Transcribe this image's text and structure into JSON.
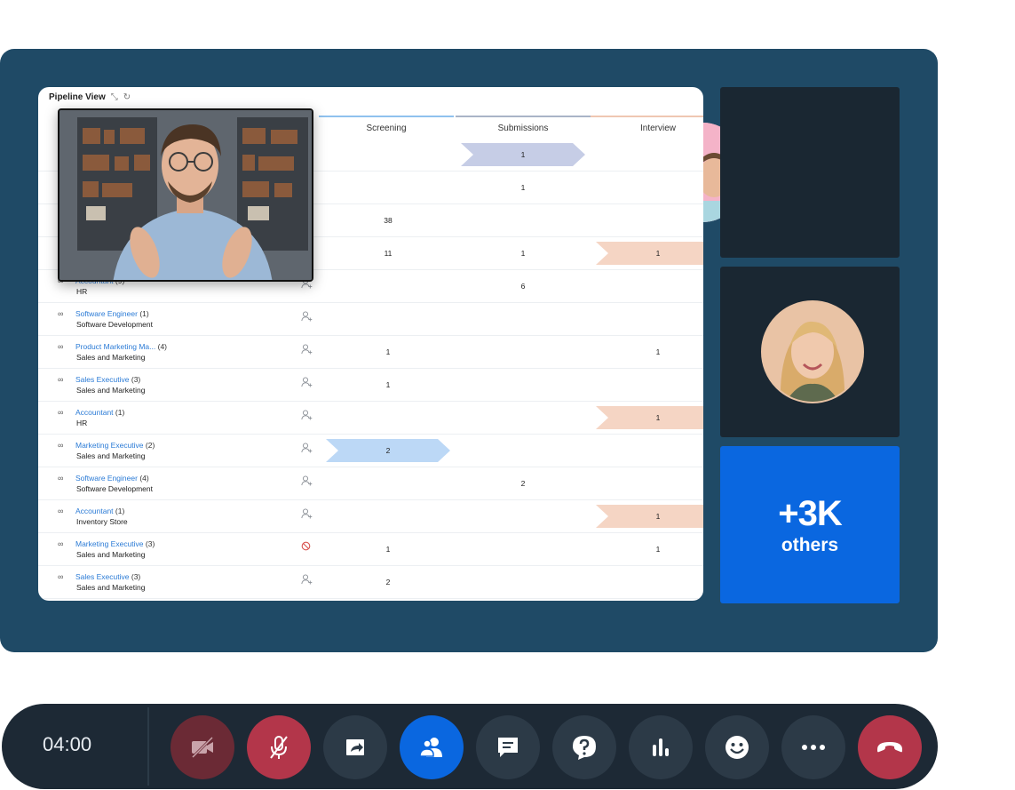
{
  "pipeline": {
    "title": "Pipeline View",
    "stages": [
      "Screening",
      "Submissions",
      "Interview"
    ],
    "rows": [
      {
        "job": "",
        "count": "",
        "dept": "",
        "cells": [
          "",
          {
            "v": "1",
            "chev": "slate"
          },
          ""
        ]
      },
      {
        "job": "",
        "count": "",
        "dept": "",
        "cells": [
          "",
          "1",
          ""
        ]
      },
      {
        "job": "",
        "count": "",
        "dept": "",
        "cells": [
          "38",
          "",
          ""
        ]
      },
      {
        "job": "",
        "count": "",
        "dept": "",
        "cells": [
          "11",
          "1",
          {
            "v": "1",
            "chev": "peach"
          }
        ]
      },
      {
        "job": "Accountant",
        "count": "(9)",
        "dept": "HR",
        "cells": [
          "",
          "6",
          ""
        ]
      },
      {
        "job": "Software Engineer",
        "count": "(1)",
        "dept": "Software Development",
        "cells": [
          "",
          "",
          ""
        ]
      },
      {
        "job": "Product Marketing Ma...",
        "count": "(4)",
        "dept": "Sales and Marketing",
        "cells": [
          "1",
          "",
          "1"
        ]
      },
      {
        "job": "Sales Executive",
        "count": "(3)",
        "dept": "Sales and Marketing",
        "cells": [
          "1",
          "",
          ""
        ]
      },
      {
        "job": "Accountant",
        "count": "(1)",
        "dept": "HR",
        "cells": [
          "",
          "",
          {
            "v": "1",
            "chev": "peach"
          }
        ]
      },
      {
        "job": "Marketing Executive",
        "count": "(2)",
        "dept": "Sales and Marketing",
        "cells": [
          {
            "v": "2",
            "chev": "blue"
          },
          "",
          ""
        ]
      },
      {
        "job": "Software Engineer",
        "count": "(4)",
        "dept": "Software Development",
        "cells": [
          "",
          "2",
          ""
        ]
      },
      {
        "job": "Accountant",
        "count": "(1)",
        "dept": "Inventory Store",
        "cells": [
          "",
          "",
          {
            "v": "1",
            "chev": "peach"
          }
        ]
      },
      {
        "job": "Marketing Executive",
        "count": "(3)",
        "dept": "Sales and Marketing",
        "cells": [
          "1",
          "",
          "1"
        ],
        "blocked": true
      },
      {
        "job": "Sales Executive",
        "count": "(3)",
        "dept": "Sales and Marketing",
        "cells": [
          "2",
          "",
          ""
        ]
      }
    ]
  },
  "participants": {
    "others_count": "+3K",
    "others_label": "others"
  },
  "controls": {
    "timer": "04:00",
    "buttons": [
      {
        "name": "video-off-button",
        "icon": "video-off-icon",
        "bg": "#6b2a35"
      },
      {
        "name": "mic-mute-button",
        "icon": "mic-off-icon",
        "bg": "#b3364a"
      },
      {
        "name": "share-screen-button",
        "icon": "share-icon",
        "bg": "#2c3a47"
      },
      {
        "name": "participants-button",
        "icon": "people-icon",
        "bg": "#0a67e0"
      },
      {
        "name": "chat-button",
        "icon": "chat-icon",
        "bg": "#2c3a47"
      },
      {
        "name": "qa-button",
        "icon": "question-icon",
        "bg": "#2c3a47"
      },
      {
        "name": "poll-button",
        "icon": "bar-chart-icon",
        "bg": "#2c3a47"
      },
      {
        "name": "reactions-button",
        "icon": "smiley-icon",
        "bg": "#2c3a47"
      },
      {
        "name": "more-options-button",
        "icon": "more-icon",
        "bg": "#2c3a47"
      },
      {
        "name": "end-call-button",
        "icon": "hang-up-icon",
        "bg": "#b3364a"
      }
    ]
  }
}
